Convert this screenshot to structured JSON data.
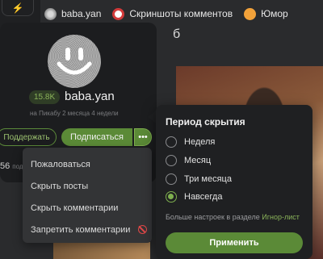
{
  "rail": {
    "icon_glyph": "⚡"
  },
  "topbar": {
    "tags": [
      {
        "label": "baba.yan",
        "icon": "user-avatar-icon"
      },
      {
        "label": "Скриншоты комментов",
        "icon": "screenshots-icon"
      },
      {
        "label": "Юмор",
        "icon": "humor-icon"
      }
    ]
  },
  "background": {
    "headline_fragment": "б"
  },
  "profile": {
    "rating": "15.8K",
    "username": "baba.yan",
    "member_since": "на Пикабу 2 месяца 4 недели",
    "support_label": "Поддержать",
    "subscribe_label": "Подписаться",
    "more_label": "•••",
    "stat_value": "56",
    "stat_label": "под"
  },
  "menu": {
    "items": [
      {
        "label": "Пожаловаться"
      },
      {
        "label": "Скрыть посты"
      },
      {
        "label": "Скрыть комментарии"
      },
      {
        "label": "Запретить комментарии",
        "icon": "ban-icon"
      }
    ]
  },
  "hide_period": {
    "title": "Период скрытия",
    "options": [
      {
        "label": "Неделя",
        "checked": false
      },
      {
        "label": "Месяц",
        "checked": false
      },
      {
        "label": "Три месяца",
        "checked": false
      },
      {
        "label": "Навсегда",
        "checked": true
      }
    ],
    "more_settings_text": "Больше настроек в разделе ",
    "more_settings_link": "Игнор-лист",
    "apply_label": "Применить"
  },
  "colors": {
    "accent": "#5b8a37",
    "accent_light": "#7fb04f",
    "danger": "#e04848",
    "panel": "#1c1d1f"
  }
}
